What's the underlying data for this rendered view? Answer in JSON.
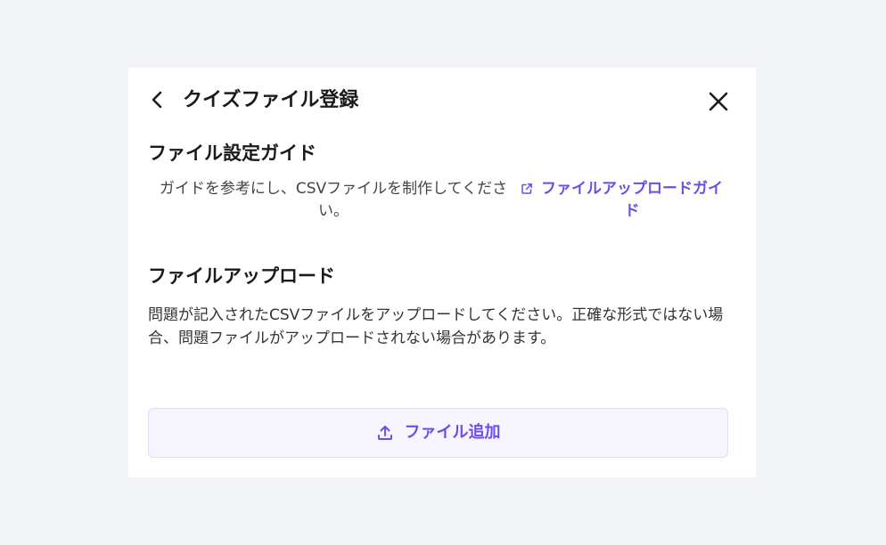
{
  "modal": {
    "title": "クイズファイル登録"
  },
  "guide": {
    "heading": "ファイル設定ガイド",
    "text": "ガイドを参考にし、CSVファイルを制作してください。",
    "link_label": "ファイルアップロードガイド"
  },
  "upload": {
    "heading": "ファイルアップロード",
    "description": "問題が記入されたCSVファイルをアップロードしてください。正確な形式ではない場合、問題ファイルがアップロードされない場合があります。",
    "add_button_label": "ファイル追加"
  },
  "colors": {
    "accent": "#6d4ce8",
    "button_bg": "#f6f4fd",
    "page_bg": "#f2f3f7"
  },
  "icons": {
    "back": "chevron-left-icon",
    "close": "close-icon",
    "external_link": "external-link-icon",
    "upload": "upload-icon"
  }
}
